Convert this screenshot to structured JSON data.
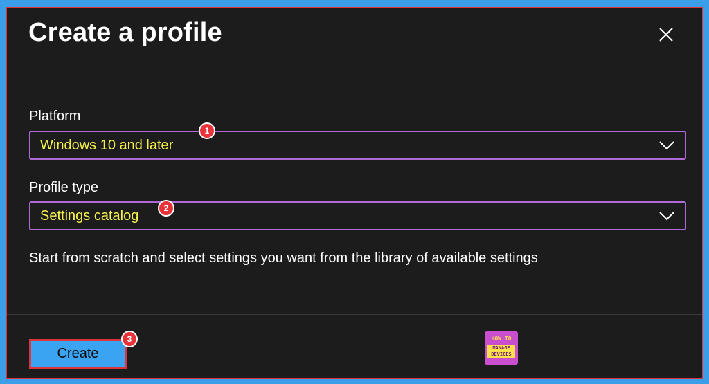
{
  "dialog": {
    "title": "Create a profile",
    "close_icon": "close-icon"
  },
  "platform": {
    "label": "Platform",
    "value": "Windows 10 and later",
    "badge": "1",
    "chevron_icon": "chevron-down-icon"
  },
  "profile_type": {
    "label": "Profile type",
    "value": "Settings catalog",
    "badge": "2",
    "chevron_icon": "chevron-down-icon"
  },
  "description": "Start from scratch and select settings you want from the library of available settings",
  "footer": {
    "create_label": "Create",
    "create_badge": "3",
    "logo_line1": "HOW TO",
    "logo_line2": "MANAGE\nDEVICES"
  },
  "colors": {
    "page_background": "#3a9ee8",
    "dialog_background": "#1c1c1c",
    "highlight_border": "#e0343c",
    "select_border": "#b06ad8",
    "select_text": "#f6f24a",
    "badge": "#e8333b",
    "primary_button": "#3aa3f2",
    "logo_background": "#c94fcf"
  }
}
